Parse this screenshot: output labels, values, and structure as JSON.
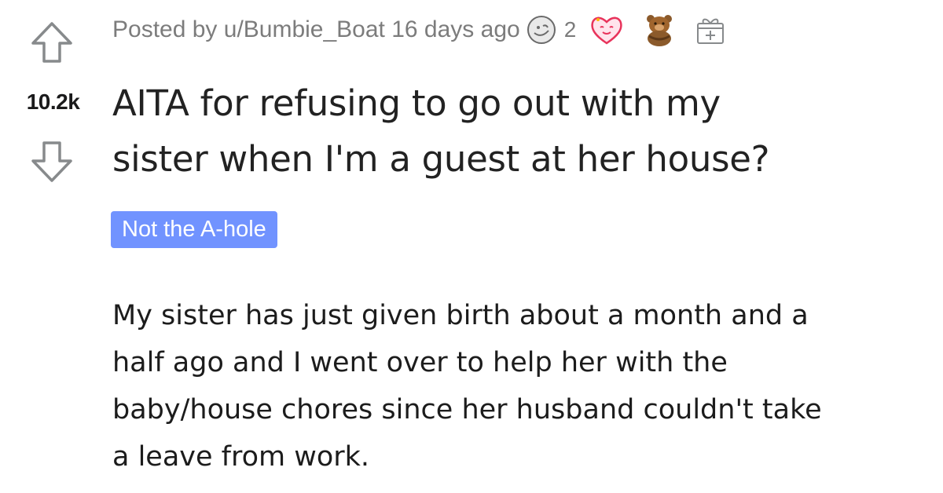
{
  "post": {
    "score": "10.2k",
    "meta_text": "Posted by u/Bumbie_Boat 16 days ago",
    "awards": [
      {
        "icon": "silver-award-icon",
        "count": "2"
      },
      {
        "icon": "wholesome-heart-award-icon"
      },
      {
        "icon": "bear-hug-award-icon"
      },
      {
        "icon": "gift-award-icon"
      }
    ],
    "title_lines": [
      "AITA for refusing to go out with my",
      "sister when I'm a guest at her house?"
    ],
    "flair": "Not the A-hole",
    "body_lines": [
      "My sister has just given birth about a month and a",
      "half ago and I went over to help her with the",
      "baby/house chores since her husband couldn't take",
      "a leave from work."
    ]
  },
  "colors": {
    "flair_bg": "#7193ff",
    "meta_text": "#7c7c7c",
    "vote_arrow": "#878a8c"
  }
}
